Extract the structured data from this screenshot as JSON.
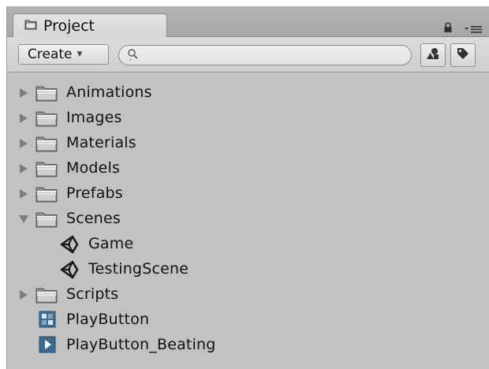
{
  "tab": {
    "title": "Project"
  },
  "toolbar": {
    "create_label": "Create",
    "search_value": "",
    "search_placeholder": ""
  },
  "tree": [
    {
      "label": "Animations",
      "kind": "folder",
      "expanded": false
    },
    {
      "label": "Images",
      "kind": "folder",
      "expanded": false
    },
    {
      "label": "Materials",
      "kind": "folder",
      "expanded": false
    },
    {
      "label": "Models",
      "kind": "folder",
      "expanded": false
    },
    {
      "label": "Prefabs",
      "kind": "folder",
      "expanded": false
    },
    {
      "label": "Scenes",
      "kind": "folder",
      "expanded": true
    },
    {
      "label": "Game",
      "kind": "scene"
    },
    {
      "label": "TestingScene",
      "kind": "scene"
    },
    {
      "label": "Scripts",
      "kind": "folder",
      "expanded": false
    },
    {
      "label": "PlayButton",
      "kind": "sprite"
    },
    {
      "label": "PlayButton_Beating",
      "kind": "animation"
    }
  ],
  "colors": {
    "panel_bg": "#c2c2c2",
    "tab_bg": "#dedede",
    "text": "#111111"
  }
}
